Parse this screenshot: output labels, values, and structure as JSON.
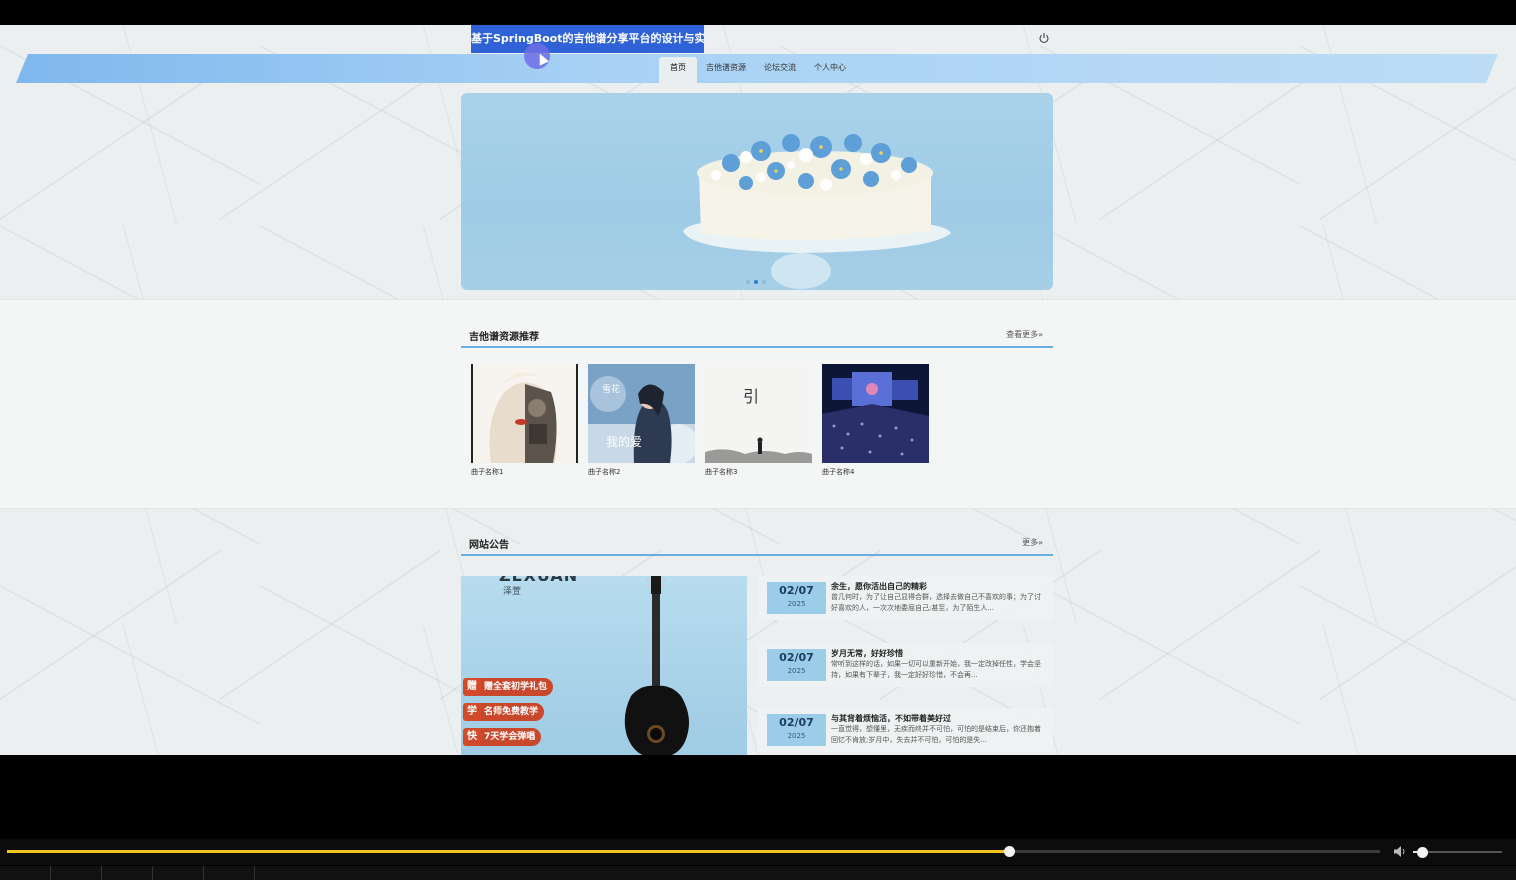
{
  "header": {
    "site_title": "基于SpringBoot的吉他谱分享平台的设计与实现",
    "power_icon": "power-icon"
  },
  "nav": {
    "items": [
      {
        "label": "首页",
        "active": true
      },
      {
        "label": "吉他谱资源",
        "active": false
      },
      {
        "label": "论坛交流",
        "active": false
      },
      {
        "label": "个人中心",
        "active": false
      }
    ]
  },
  "banner": {
    "slide_count": 3,
    "active_index": 1,
    "image": "blue-flower-cake"
  },
  "recommend": {
    "title": "吉他谱资源推荐",
    "more_label": "查看更多»",
    "items": [
      {
        "name": "曲子名称1",
        "image": "album-cover-portrait-robot"
      },
      {
        "name": "曲子名称2",
        "image": "album-cover-woman-snow"
      },
      {
        "name": "曲子名称3",
        "image": "album-cover-minimal-figure"
      },
      {
        "name": "曲子名称4",
        "image": "concert-crowd-photo"
      }
    ]
  },
  "notice": {
    "title": "网站公告",
    "more_label": "更多»",
    "ad": {
      "brand": "ZEXUAN",
      "brand_cn": "泽萱",
      "tags": [
        {
          "key": "赠",
          "text": "赠全套初学礼包"
        },
        {
          "key": "学",
          "text": "名师免费教学"
        },
        {
          "key": "快",
          "text": "7天学会弹唱"
        }
      ]
    },
    "items": [
      {
        "date_md": "02/07",
        "year": "2025",
        "title": "余生，愿你活出自己的精彩",
        "summary": "曾几何时，为了让自己显得合群，选择去做自己不喜欢的事；为了讨好喜欢的人，一次次地委屈自己;甚至，为了陌生人..."
      },
      {
        "date_md": "02/07",
        "year": "2025",
        "title": "岁月无常，好好珍惜",
        "summary": "常听到这样的话，如果一切可以重新开始，我一定改掉任性，学会坚持，如果有下辈子，我一定好好珍惜，不会再..."
      },
      {
        "date_md": "02/07",
        "year": "2025",
        "title": "与其背着烦恼活，不如带着美好过",
        "summary": "一直觉得，想懂里，无疾而终并不可怕，可怕的是结束后，你还抱着回忆不肯放;岁月中，失去并不可怕，可怕的是失..."
      }
    ]
  },
  "player": {
    "progress": 0.73,
    "volume": 0.1
  }
}
